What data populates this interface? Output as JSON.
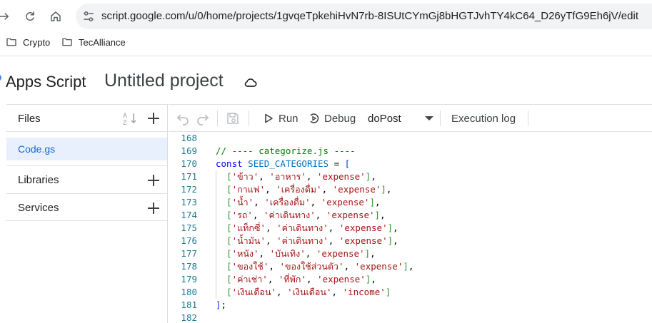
{
  "browser": {
    "url": "script.google.com/u/0/home/projects/1gvqeTpkehiHvN7rb-8ISUtCYmGj8bHGTJvhTY4kC64_D26yTfG9Eh6jV/edit",
    "bookmarks": [
      {
        "label": "Crypto",
        "icon": "folder-icon"
      },
      {
        "label": "TecAlliance",
        "icon": "folder-icon"
      }
    ]
  },
  "app": {
    "name": "Apps Script",
    "project_title": "Untitled project",
    "brand_color": "#4285f4"
  },
  "sidebar": {
    "files_label": "Files",
    "files": [
      {
        "name": "Code.gs",
        "selected": true
      }
    ],
    "libraries_label": "Libraries",
    "services_label": "Services"
  },
  "toolbar": {
    "run_label": "Run",
    "debug_label": "Debug",
    "function_selected": "doPost",
    "execution_log_label": "Execution log"
  },
  "editor": {
    "lines": [
      {
        "num": "168",
        "tokens": []
      },
      {
        "num": "169",
        "tokens": [
          {
            "t": "// ---- categorize.js ----",
            "c": "com"
          }
        ]
      },
      {
        "num": "170",
        "tokens": [
          {
            "t": "const",
            "c": "kw"
          },
          {
            "t": " ",
            "c": "punc"
          },
          {
            "t": "SEED_CATEGORIES",
            "c": "var"
          },
          {
            "t": " = ",
            "c": "punc"
          },
          {
            "t": "[",
            "c": "br1"
          }
        ]
      },
      {
        "num": "171",
        "tokens": [
          {
            "t": "  ",
            "c": "punc"
          },
          {
            "t": "[",
            "c": "br2"
          },
          {
            "t": "'ข้าว'",
            "c": "str"
          },
          {
            "t": ", ",
            "c": "punc"
          },
          {
            "t": "'อาหาร'",
            "c": "str"
          },
          {
            "t": ", ",
            "c": "punc"
          },
          {
            "t": "'expense'",
            "c": "str"
          },
          {
            "t": "]",
            "c": "br2"
          },
          {
            "t": ",",
            "c": "punc"
          }
        ]
      },
      {
        "num": "172",
        "tokens": [
          {
            "t": "  ",
            "c": "punc"
          },
          {
            "t": "[",
            "c": "br2"
          },
          {
            "t": "'กาแฟ'",
            "c": "str"
          },
          {
            "t": ", ",
            "c": "punc"
          },
          {
            "t": "'เครื่องดื่ม'",
            "c": "str"
          },
          {
            "t": ", ",
            "c": "punc"
          },
          {
            "t": "'expense'",
            "c": "str"
          },
          {
            "t": "]",
            "c": "br2"
          },
          {
            "t": ",",
            "c": "punc"
          }
        ]
      },
      {
        "num": "173",
        "tokens": [
          {
            "t": "  ",
            "c": "punc"
          },
          {
            "t": "[",
            "c": "br2"
          },
          {
            "t": "'น้ำ'",
            "c": "str"
          },
          {
            "t": ", ",
            "c": "punc"
          },
          {
            "t": "'เครื่องดื่ม'",
            "c": "str"
          },
          {
            "t": ", ",
            "c": "punc"
          },
          {
            "t": "'expense'",
            "c": "str"
          },
          {
            "t": "]",
            "c": "br2"
          },
          {
            "t": ",",
            "c": "punc"
          }
        ]
      },
      {
        "num": "174",
        "tokens": [
          {
            "t": "  ",
            "c": "punc"
          },
          {
            "t": "[",
            "c": "br2"
          },
          {
            "t": "'รถ'",
            "c": "str"
          },
          {
            "t": ", ",
            "c": "punc"
          },
          {
            "t": "'ค่าเดินทาง'",
            "c": "str"
          },
          {
            "t": ", ",
            "c": "punc"
          },
          {
            "t": "'expense'",
            "c": "str"
          },
          {
            "t": "]",
            "c": "br2"
          },
          {
            "t": ",",
            "c": "punc"
          }
        ]
      },
      {
        "num": "175",
        "tokens": [
          {
            "t": "  ",
            "c": "punc"
          },
          {
            "t": "[",
            "c": "br2"
          },
          {
            "t": "'แท็กซี่'",
            "c": "str"
          },
          {
            "t": ", ",
            "c": "punc"
          },
          {
            "t": "'ค่าเดินทาง'",
            "c": "str"
          },
          {
            "t": ", ",
            "c": "punc"
          },
          {
            "t": "'expense'",
            "c": "str"
          },
          {
            "t": "]",
            "c": "br2"
          },
          {
            "t": ",",
            "c": "punc"
          }
        ]
      },
      {
        "num": "176",
        "tokens": [
          {
            "t": "  ",
            "c": "punc"
          },
          {
            "t": "[",
            "c": "br2"
          },
          {
            "t": "'น้ำมัน'",
            "c": "str"
          },
          {
            "t": ", ",
            "c": "punc"
          },
          {
            "t": "'ค่าเดินทาง'",
            "c": "str"
          },
          {
            "t": ", ",
            "c": "punc"
          },
          {
            "t": "'expense'",
            "c": "str"
          },
          {
            "t": "]",
            "c": "br2"
          },
          {
            "t": ",",
            "c": "punc"
          }
        ]
      },
      {
        "num": "177",
        "tokens": [
          {
            "t": "  ",
            "c": "punc"
          },
          {
            "t": "[",
            "c": "br2"
          },
          {
            "t": "'หนัง'",
            "c": "str"
          },
          {
            "t": ", ",
            "c": "punc"
          },
          {
            "t": "'บันเทิง'",
            "c": "str"
          },
          {
            "t": ", ",
            "c": "punc"
          },
          {
            "t": "'expense'",
            "c": "str"
          },
          {
            "t": "]",
            "c": "br2"
          },
          {
            "t": ",",
            "c": "punc"
          }
        ]
      },
      {
        "num": "178",
        "tokens": [
          {
            "t": "  ",
            "c": "punc"
          },
          {
            "t": "[",
            "c": "br2"
          },
          {
            "t": "'ของใช้'",
            "c": "str"
          },
          {
            "t": ", ",
            "c": "punc"
          },
          {
            "t": "'ของใช้ส่วนตัว'",
            "c": "str"
          },
          {
            "t": ", ",
            "c": "punc"
          },
          {
            "t": "'expense'",
            "c": "str"
          },
          {
            "t": "]",
            "c": "br2"
          },
          {
            "t": ",",
            "c": "punc"
          }
        ]
      },
      {
        "num": "179",
        "tokens": [
          {
            "t": "  ",
            "c": "punc"
          },
          {
            "t": "[",
            "c": "br2"
          },
          {
            "t": "'ค่าเช่า'",
            "c": "str"
          },
          {
            "t": ", ",
            "c": "punc"
          },
          {
            "t": "'ที่พัก'",
            "c": "str"
          },
          {
            "t": ", ",
            "c": "punc"
          },
          {
            "t": "'expense'",
            "c": "str"
          },
          {
            "t": "]",
            "c": "br2"
          },
          {
            "t": ",",
            "c": "punc"
          }
        ]
      },
      {
        "num": "180",
        "tokens": [
          {
            "t": "  ",
            "c": "punc"
          },
          {
            "t": "[",
            "c": "br2"
          },
          {
            "t": "'เงินเดือน'",
            "c": "str"
          },
          {
            "t": ", ",
            "c": "punc"
          },
          {
            "t": "'เงินเดือน'",
            "c": "str"
          },
          {
            "t": ", ",
            "c": "punc"
          },
          {
            "t": "'income'",
            "c": "str"
          },
          {
            "t": "]",
            "c": "br2"
          }
        ]
      },
      {
        "num": "181",
        "tokens": [
          {
            "t": "]",
            "c": "br1"
          },
          {
            "t": ";",
            "c": "punc"
          }
        ]
      },
      {
        "num": "182",
        "tokens": []
      }
    ]
  }
}
